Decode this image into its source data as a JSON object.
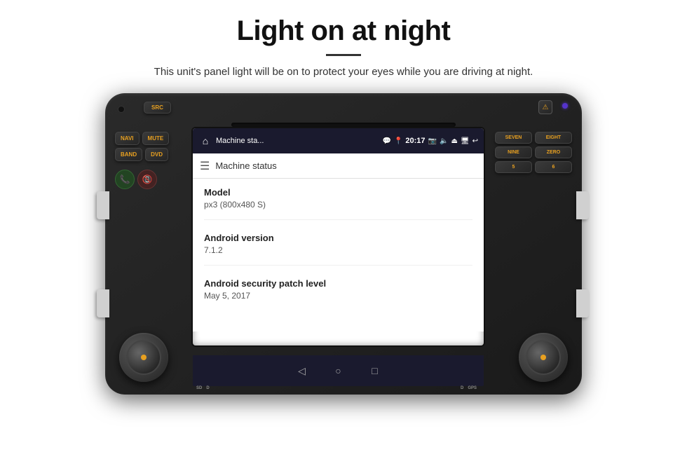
{
  "page": {
    "title": "Light on at night",
    "subtitle": "This unit's panel light will be on to protect your eyes while you are driving at night.",
    "divider": true
  },
  "device": {
    "statusbar": {
      "title": "Machine sta...",
      "icons": "💬 📍",
      "time": "20:17"
    },
    "header": {
      "title": "Machine status",
      "icon": "☰"
    },
    "sections": [
      {
        "label": "Model",
        "value": "px3 (800x480 S)"
      },
      {
        "label": "Android version",
        "value": "7.1.2"
      },
      {
        "label": "Android security patch level",
        "value": "May 5, 2017"
      }
    ],
    "buttons": {
      "left": [
        {
          "label": "NAVI"
        },
        {
          "label": "MUTE"
        },
        {
          "label": "BAND"
        },
        {
          "label": "DVD"
        }
      ],
      "right_numbers": [
        {
          "label": "SEVEN"
        },
        {
          "label": "EIGHT"
        },
        {
          "label": "NINE"
        },
        {
          "label": "ZERO"
        },
        {
          "label": "5"
        },
        {
          "label": "6"
        }
      ]
    },
    "top_src": "SRC"
  }
}
